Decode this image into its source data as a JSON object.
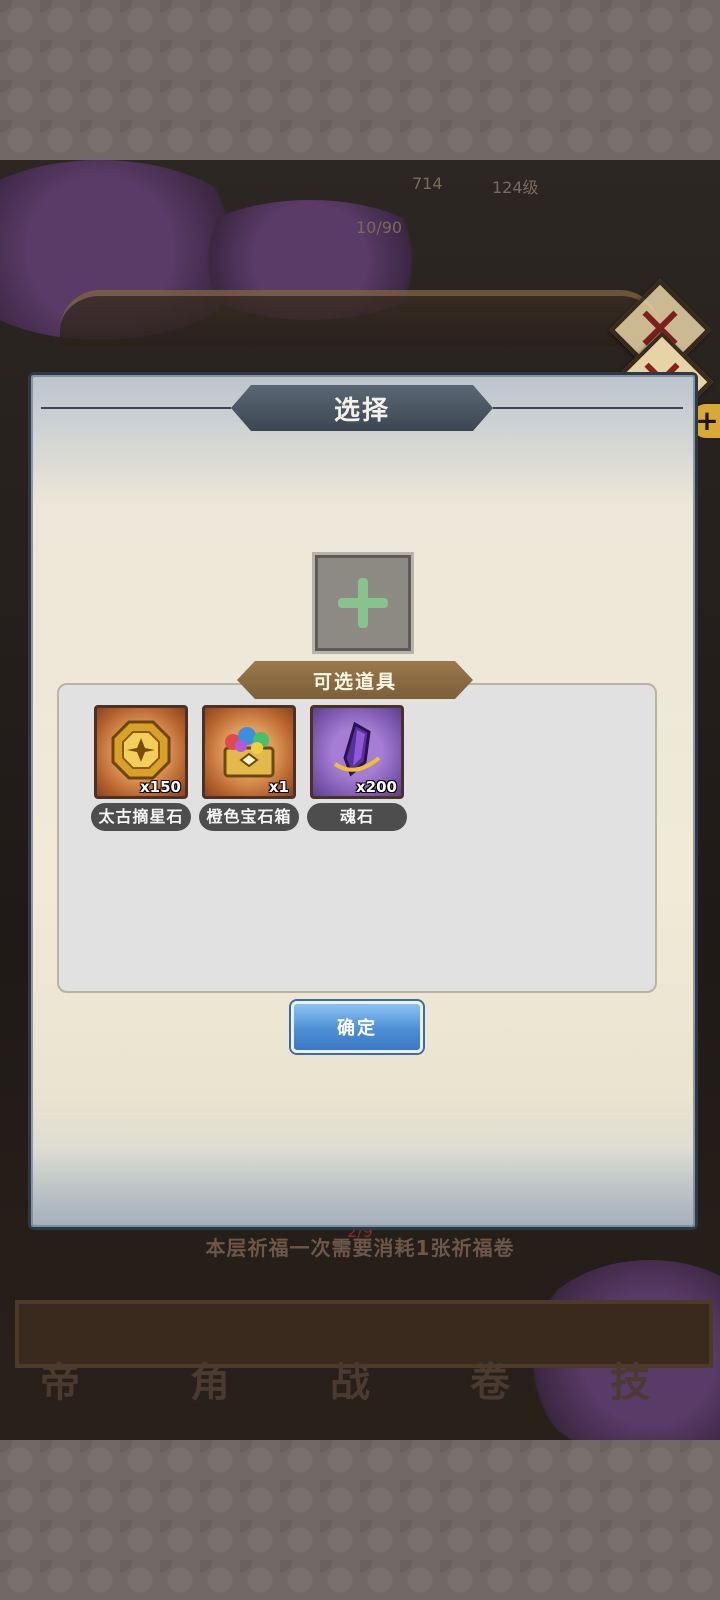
{
  "dialog": {
    "title": "选择",
    "list_header": "可选道具",
    "confirm_label": "确定",
    "items": [
      {
        "name": "太古摘星石",
        "count": "x150",
        "icon": "octagon-star-stone-icon"
      },
      {
        "name": "橙色宝石箱",
        "count": "x1",
        "icon": "gem-chest-icon"
      },
      {
        "name": "魂石",
        "count": "x200",
        "icon": "purple-soul-stone-icon"
      }
    ]
  },
  "background": {
    "top_stat_a": "714",
    "top_stat_b": "124级",
    "progress": "10/90",
    "pray_count": "2/9",
    "pray_hint": "本层祈福一次需要消耗1张祈福卷",
    "bottom_tabs": [
      "帝",
      "角",
      "战",
      "卷",
      "技"
    ]
  },
  "colors": {
    "dialog_border": "#2d3947",
    "list_header": "#8a6a40",
    "confirm": "#4d8fd6",
    "plus": "#87c48d"
  }
}
